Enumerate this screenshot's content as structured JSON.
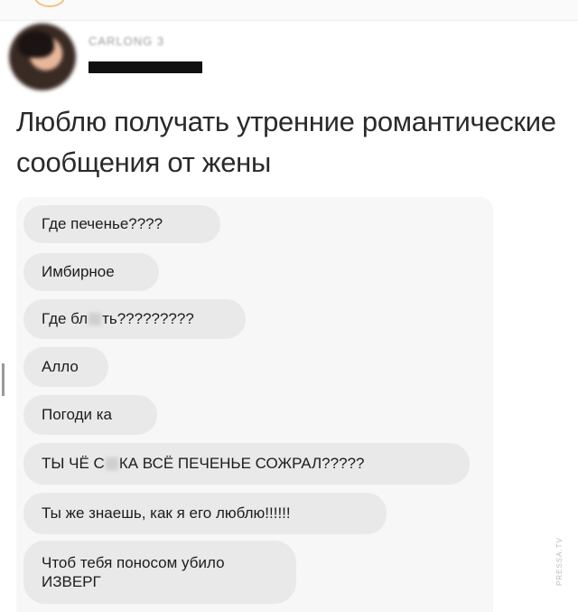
{
  "post": {
    "username": "CARLONG 3",
    "caption": "Люблю получать утренние романтические сообщения от жены"
  },
  "chat": {
    "messages": [
      {
        "text": "Где печенье????"
      },
      {
        "text": "Имбирное"
      },
      {
        "text_before": "Где бл",
        "text_after": "ть?????????"
      },
      {
        "text": "Алло"
      },
      {
        "text": "Погоди ка"
      },
      {
        "text_before": "ТЫ ЧЁ С",
        "text_after": "КА ВСЁ ПЕЧЕНЬЕ СОЖРАЛ?????"
      },
      {
        "text": "Ты же знаешь, как я его люблю!!!!!!"
      },
      {
        "text": "Чтоб тебя поносом убило ИЗВЕРГ"
      }
    ]
  },
  "watermark": "PRESSA.TV",
  "colors": {
    "bubble": "#e9e9ea",
    "chat_background": "#f7f7f7",
    "text": "#1c1c1c"
  }
}
